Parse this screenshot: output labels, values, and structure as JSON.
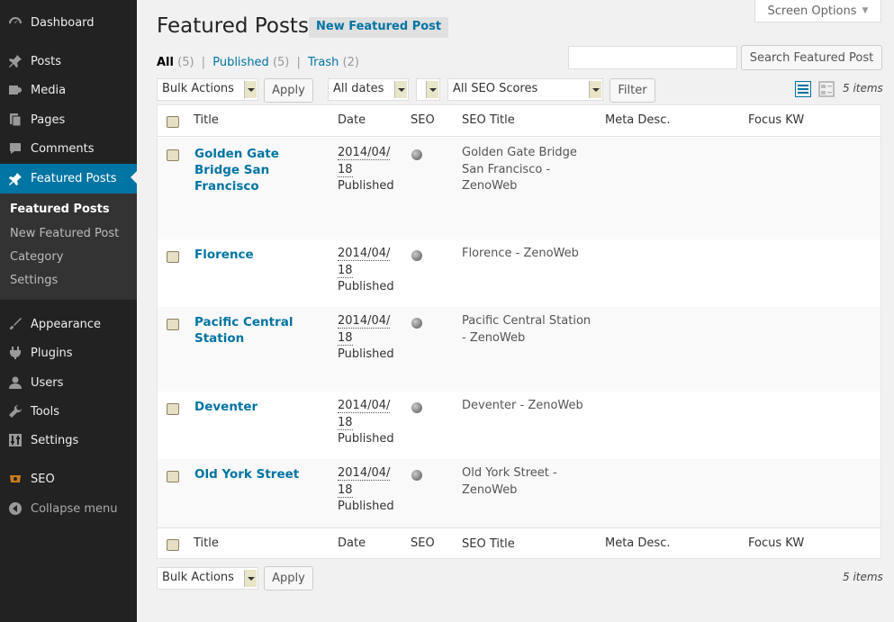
{
  "sidebar": {
    "items": [
      {
        "label": "Dashboard",
        "icon": "dashboard-icon"
      },
      {
        "label": "Posts",
        "icon": "pin-icon"
      },
      {
        "label": "Media",
        "icon": "media-icon"
      },
      {
        "label": "Pages",
        "icon": "pages-icon"
      },
      {
        "label": "Comments",
        "icon": "comment-icon"
      },
      {
        "label": "Featured Posts",
        "icon": "pin-icon"
      },
      {
        "label": "Appearance",
        "icon": "brush-icon"
      },
      {
        "label": "Plugins",
        "icon": "plugin-icon"
      },
      {
        "label": "Users",
        "icon": "user-icon"
      },
      {
        "label": "Tools",
        "icon": "wrench-icon"
      },
      {
        "label": "Settings",
        "icon": "settings-icon"
      },
      {
        "label": "SEO",
        "icon": "seo-icon"
      },
      {
        "label": "Collapse menu",
        "icon": "collapse-icon"
      }
    ],
    "submenu": [
      "Featured Posts",
      "New Featured Post",
      "Category",
      "Settings"
    ]
  },
  "screen_options": "Screen Options",
  "page": {
    "title": "Featured Posts",
    "add_new": "New Featured Post"
  },
  "views": {
    "all_label": "All",
    "all_count": "(5)",
    "published_label": "Published",
    "published_count": "(5)",
    "trash_label": "Trash",
    "trash_count": "(2)",
    "sep": "|"
  },
  "search": {
    "value": "",
    "button": "Search Featured Post"
  },
  "filters": {
    "bulk_actions": "Bulk Actions",
    "apply": "Apply",
    "dates": "All dates",
    "category": "",
    "seo_scores": "All SEO Scores",
    "filter": "Filter"
  },
  "items_count": "5 items",
  "columns": [
    "Title",
    "Date",
    "SEO",
    "SEO Title",
    "Meta Desc.",
    "Focus KW"
  ],
  "posts": [
    {
      "title": "Golden Gate Bridge San Francisco",
      "date1": "2014/04/",
      "date2": "18",
      "status": "Published",
      "seo_title": "Golden Gate Bridge San Francisco - ZenoWeb"
    },
    {
      "title": "Florence",
      "date1": "2014/04/",
      "date2": "18",
      "status": "Published",
      "seo_title": "Florence - ZenoWeb"
    },
    {
      "title": "Pacific Central Station",
      "date1": "2014/04/",
      "date2": "18",
      "status": "Published",
      "seo_title": "Pacific Central Station - ZenoWeb"
    },
    {
      "title": "Deventer",
      "date1": "2014/04/",
      "date2": "18",
      "status": "Published",
      "seo_title": "Deventer - ZenoWeb"
    },
    {
      "title": "Old York Street",
      "date1": "2014/04/",
      "date2": "18",
      "status": "Published",
      "seo_title": "Old York Street - ZenoWeb"
    }
  ],
  "colors": {
    "sidebar_bg": "#222222",
    "accent": "#0074a2",
    "page_bg": "#f1f1f1"
  }
}
